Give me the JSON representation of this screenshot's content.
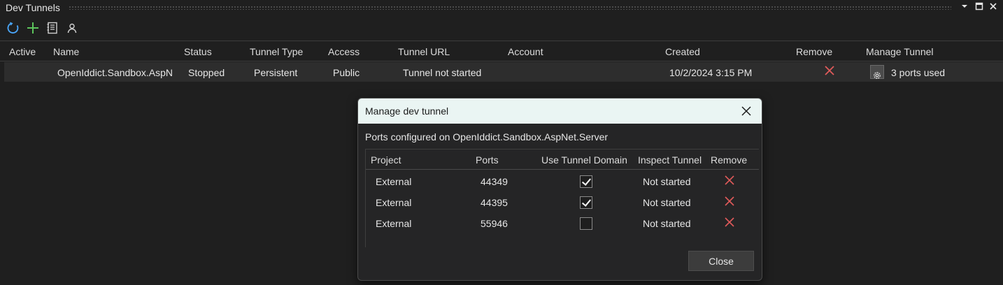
{
  "window": {
    "title": "Dev Tunnels",
    "controls": [
      "dropdown-icon",
      "maximize-icon",
      "close-icon"
    ]
  },
  "toolbar": {
    "buttons": [
      "refresh-icon",
      "add-icon",
      "notebook-icon",
      "account-icon"
    ]
  },
  "table": {
    "columns": [
      "Active",
      "Name",
      "Status",
      "Tunnel Type",
      "Access",
      "Tunnel URL",
      "Account",
      "Created",
      "Remove",
      "Manage Tunnel"
    ],
    "rows": [
      {
        "active": "",
        "name": "OpenIddict.Sandbox.AspN",
        "status": "Stopped",
        "tunnel_type": "Persistent",
        "access": "Public",
        "tunnel_url": "Tunnel not started",
        "account": "",
        "created": "10/2/2024 3:15 PM",
        "manage": "3 ports used"
      }
    ]
  },
  "dialog": {
    "title": "Manage dev tunnel",
    "subtitle": "Ports configured on OpenIddict.Sandbox.AspNet.Server",
    "columns": [
      "Project",
      "Ports",
      "Use Tunnel Domain",
      "Inspect Tunnel",
      "Remove"
    ],
    "rows": [
      {
        "project": "External",
        "port": "44349",
        "use_tunnel_domain": true,
        "inspect": "Not started"
      },
      {
        "project": "External",
        "port": "44395",
        "use_tunnel_domain": true,
        "inspect": "Not started"
      },
      {
        "project": "External",
        "port": "55946",
        "use_tunnel_domain": false,
        "inspect": "Not started"
      }
    ],
    "close_label": "Close"
  },
  "colors": {
    "background": "#1f1f1f",
    "row_highlight": "#2d2d2d",
    "remove_red": "#e05a5a",
    "accent_blue": "#4aa8ff",
    "add_green": "#5cc45c",
    "dialog_title_bg": "#eaf5f3"
  }
}
